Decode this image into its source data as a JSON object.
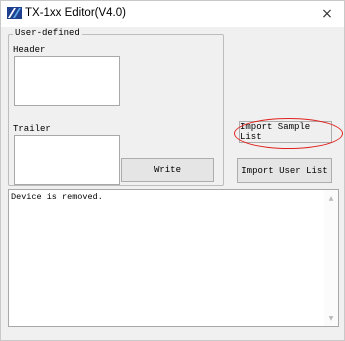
{
  "window": {
    "title": "TX-1xx Editor(V4.0)",
    "close_glyph": "×",
    "app_icon": "app-logo-icon"
  },
  "user_defined": {
    "legend": "User-defined",
    "header_label": "Header",
    "header_value": "",
    "trailer_label": "Trailer",
    "trailer_value": "",
    "write_label": "Write"
  },
  "buttons": {
    "import_sample_label": "Import Sample List",
    "import_user_label": "Import User List"
  },
  "log": {
    "text": "Device is removed."
  },
  "colors": {
    "highlight": "#e0231e",
    "window_bg": "#f0f0f0"
  }
}
